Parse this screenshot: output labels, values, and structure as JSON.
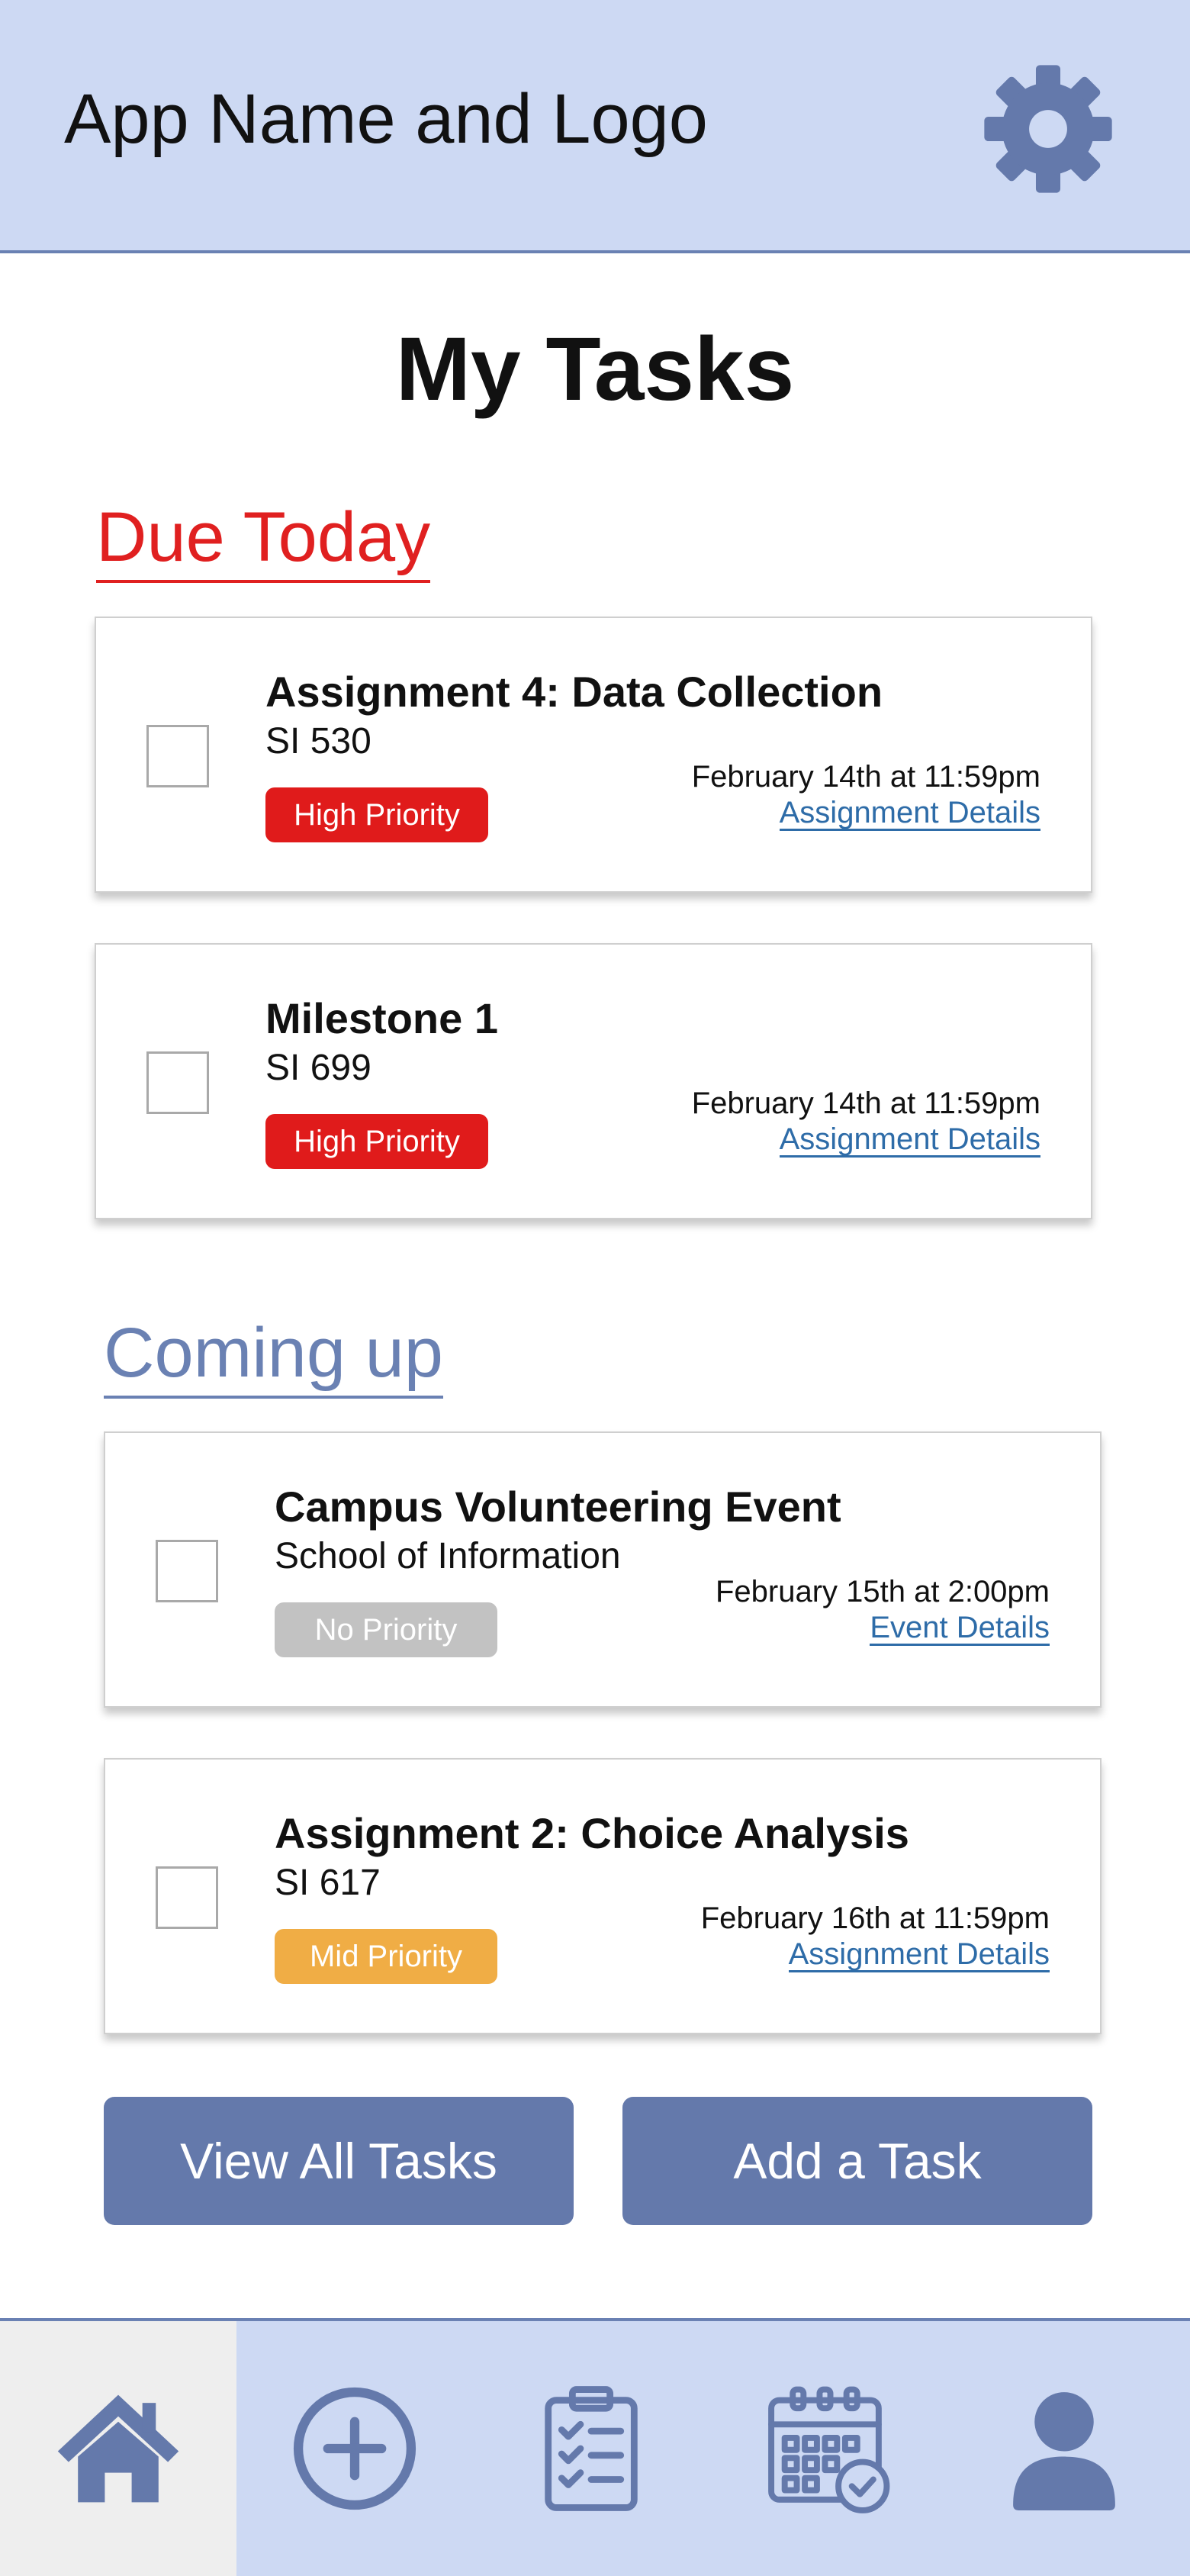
{
  "header": {
    "app_title": "App Name and Logo",
    "settings_icon": "gear-icon"
  },
  "page_title": "My Tasks",
  "sections": {
    "due_today": {
      "title": "Due Today",
      "color": "#e02020",
      "tasks": [
        {
          "title": "Assignment 4: Data Collection",
          "course": "SI 530",
          "priority": "High Priority",
          "priority_color": "#e01b1b",
          "due": "February 14th at 11:59pm",
          "link": "Assignment Details",
          "checked": false
        },
        {
          "title": "Milestone 1",
          "course": "SI 699",
          "priority": "High Priority",
          "priority_color": "#e01b1b",
          "due": "February 14th at 11:59pm",
          "link": "Assignment Details",
          "checked": false
        }
      ]
    },
    "coming_up": {
      "title": "Coming up",
      "color": "#6a81b3",
      "tasks": [
        {
          "title": "Campus Volunteering Event",
          "course": "School of Information",
          "priority": "No Priority",
          "priority_color": "#c2c2c2",
          "due": "February 15th at 2:00pm",
          "link": "Event Details",
          "checked": false
        },
        {
          "title": "Assignment 2: Choice Analysis",
          "course": "SI 617",
          "priority": "Mid Priority",
          "priority_color": "#f0ad45",
          "due": "February 16th at 11:59pm",
          "link": "Assignment Details",
          "checked": false
        }
      ]
    }
  },
  "actions": {
    "view_all": "View All Tasks",
    "add_task": "Add a Task"
  },
  "bottom_nav": {
    "items": [
      {
        "icon": "home-icon",
        "active": true
      },
      {
        "icon": "add-circle-icon",
        "active": false
      },
      {
        "icon": "clipboard-checklist-icon",
        "active": false
      },
      {
        "icon": "calendar-check-icon",
        "active": false
      },
      {
        "icon": "profile-icon",
        "active": false
      }
    ]
  },
  "colors": {
    "header_bg": "#cdd9f3",
    "accent": "#6479ab",
    "icon": "#6479ab",
    "link": "#2e6ca8"
  }
}
